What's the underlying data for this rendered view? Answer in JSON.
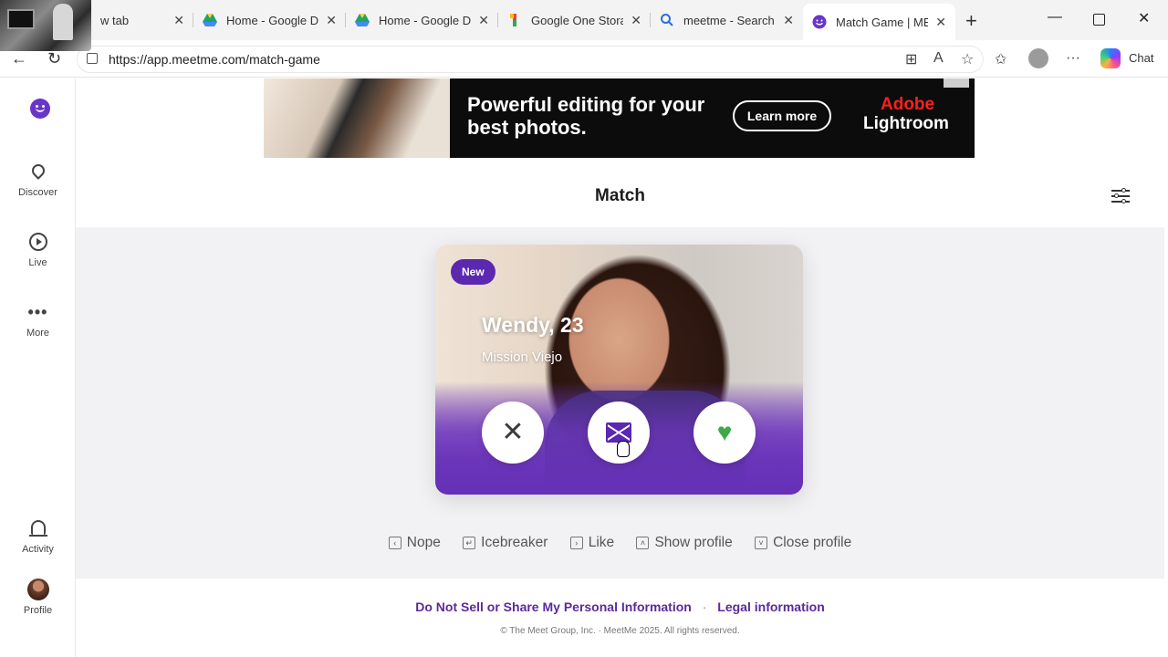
{
  "browser": {
    "tabs": [
      {
        "title": "w tab",
        "favicon": "new-tab-icon"
      },
      {
        "title": "Home - Google Dr",
        "favicon": "google-drive-icon"
      },
      {
        "title": "Home - Google Dr",
        "favicon": "google-drive-icon"
      },
      {
        "title": "Google One Storag",
        "favicon": "google-one-icon"
      },
      {
        "title": "meetme - Search",
        "favicon": "search-icon"
      },
      {
        "title": "Match Game | MEE",
        "favicon": "meetme-icon",
        "active": true
      }
    ],
    "url": "https://app.meetme.com/match-game",
    "chat_label": "Chat"
  },
  "sidebar": {
    "items": [
      {
        "label": "Discover",
        "icon": "location-pin-icon"
      },
      {
        "label": "Live",
        "icon": "play-circle-icon"
      },
      {
        "label": "More",
        "icon": "more-dots-icon"
      },
      {
        "label": "Activity",
        "icon": "bell-icon"
      },
      {
        "label": "Profile",
        "icon": "avatar"
      }
    ]
  },
  "ad": {
    "headline": "Powerful editing for your best photos.",
    "button": "Learn more",
    "brand_top": "Adobe",
    "brand_bottom": "Lightroom"
  },
  "page": {
    "title": "Match"
  },
  "card": {
    "badge": "New",
    "name": "Wendy, 23",
    "location": "Mission Viejo"
  },
  "shortcuts": [
    {
      "key": "‹",
      "label": "Nope"
    },
    {
      "key": "↵",
      "label": "Icebreaker"
    },
    {
      "key": "›",
      "label": "Like"
    },
    {
      "key": "˄",
      "label": "Show profile"
    },
    {
      "key": "˅",
      "label": "Close profile"
    }
  ],
  "footer": {
    "link_privacy": "Do Not Sell or Share My Personal Information",
    "separator": "·",
    "link_legal": "Legal information",
    "copyright": "© The Meet Group, Inc. · MeetMe 2025. All rights reserved."
  },
  "colors": {
    "brand_purple": "#5b28b0",
    "like_green": "#3daa4a",
    "stage_bg": "#f2f2f4"
  }
}
